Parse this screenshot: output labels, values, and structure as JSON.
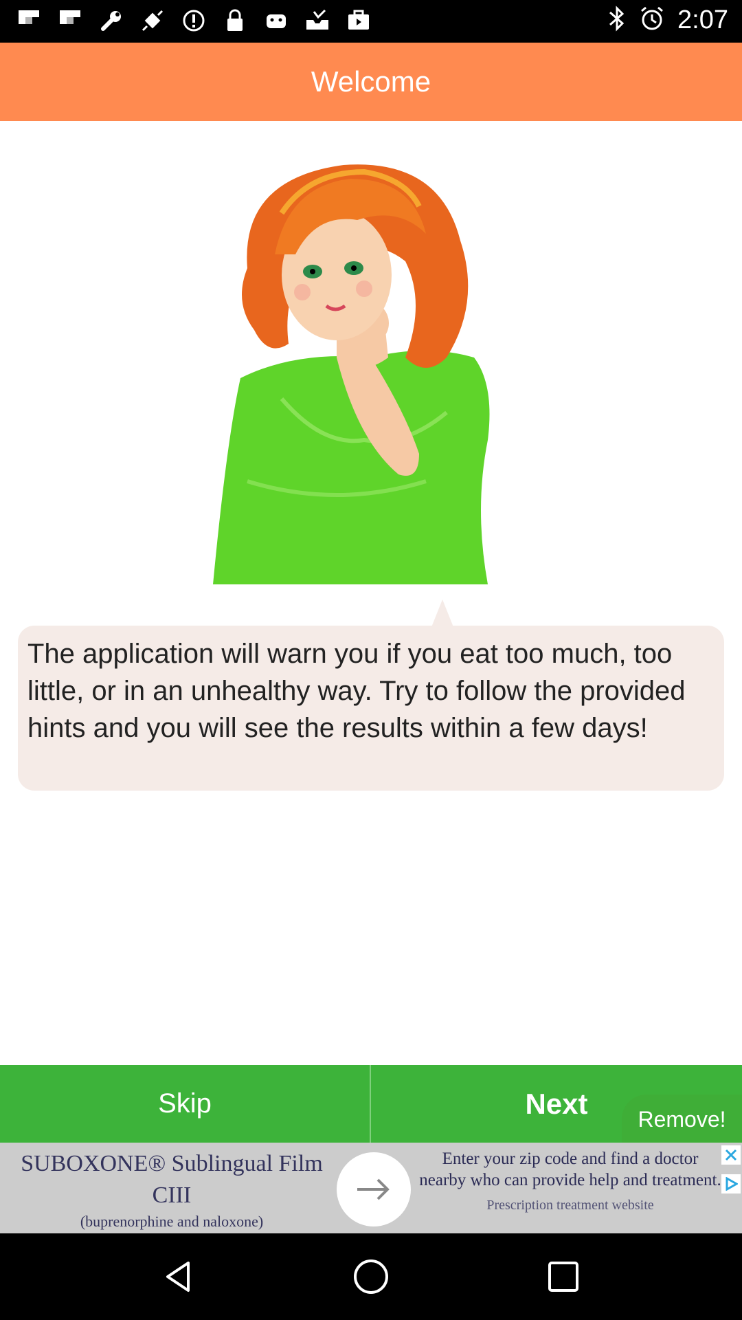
{
  "status_bar": {
    "time": "2:07",
    "left_icons": [
      "flipboard-icon",
      "flipboard-icon",
      "wrench-icon",
      "fake-gps-icon",
      "info-icon",
      "lock-icon",
      "android-icon",
      "inbox-icon",
      "briefcase-icon"
    ],
    "right_icons": [
      "bluetooth-icon",
      "alarm-icon"
    ]
  },
  "header": {
    "title": "Welcome"
  },
  "illustration": {
    "icon": "cartoon-girl-image",
    "hair_color": "#e8661e",
    "dress_color": "#5fd42a"
  },
  "speech": {
    "text": "The application will warn you if you eat too much, too little, or in an unhealthy way. Try to follow the provided hints and you will see the results within a few days!"
  },
  "buttons": {
    "skip_label": "Skip",
    "next_label": "Next",
    "remove_label": "Remove!"
  },
  "ad": {
    "title": "SUBOXONE® Sublingual Film CIII",
    "subtitle": "(buprenorphine and naloxone)",
    "body": "Enter your zip code and find a doctor nearby who can provide help and treatment.",
    "footer": "Prescription treatment website"
  },
  "colors": {
    "header": "#ff8a50",
    "button_green": "#3db33a",
    "bubble": "#f5ebe7"
  }
}
